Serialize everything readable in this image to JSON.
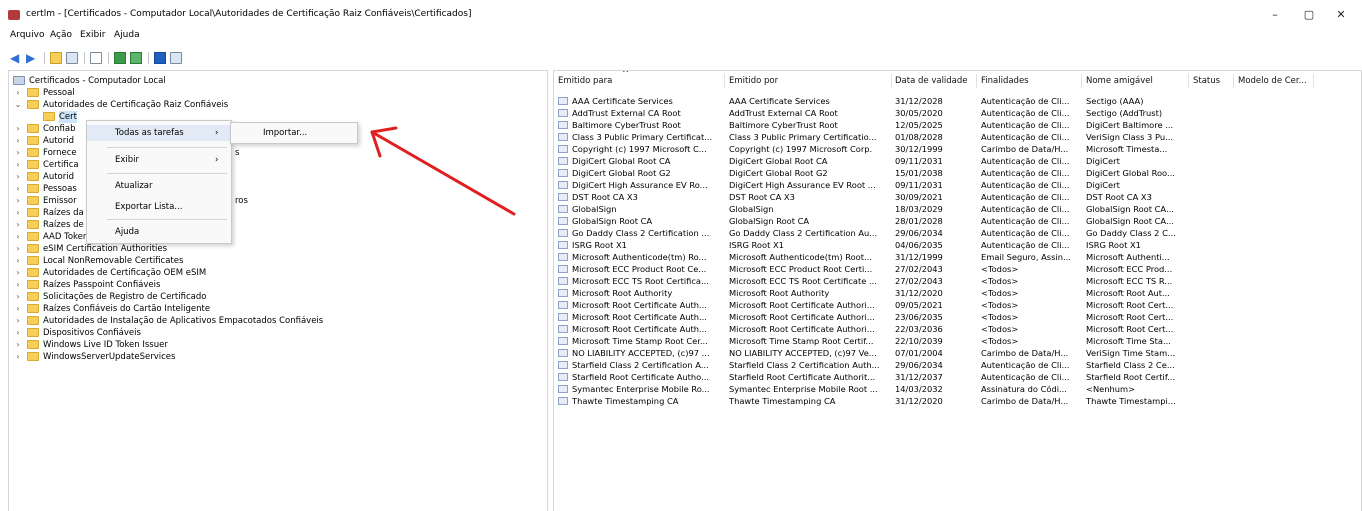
{
  "window": {
    "title": "certlm - [Certificados - Computador Local\\Autoridades de Certificação Raiz Confiáveis\\Certificados]",
    "minimize_glyph": "–",
    "maximize_glyph": "▢",
    "close_glyph": "✕"
  },
  "menu": [
    "Arquivo",
    "Ação",
    "Exibir",
    "Ajuda"
  ],
  "toolbar_icons": [
    "back-arrow-icon",
    "forward-arrow-icon",
    "up-folder-icon",
    "show-hide-tree-icon",
    "delete-icon",
    "refresh-icon",
    "export-list-icon",
    "help-icon",
    "properties-icon"
  ],
  "tree": {
    "root": "Certificados - Computador Local",
    "items": [
      {
        "label": "Pessoal",
        "chev": "›"
      },
      {
        "label": "Autoridades de Certificação Raiz Confiáveis",
        "chev": "⌄"
      },
      {
        "label": "Cert",
        "chev": ""
      },
      {
        "label": "Confiab",
        "chev": "›"
      },
      {
        "label": "Autorid",
        "chev": "›"
      },
      {
        "label": "Fornece",
        "chev": "›"
      },
      {
        "label": "Certifica",
        "chev": "›"
      },
      {
        "label": "Autorid",
        "chev": "›"
      },
      {
        "label": "Pessoas",
        "chev": "›"
      },
      {
        "label": "Emissor",
        "chev": "›"
      },
      {
        "label": "Raízes da Versão Prévia",
        "chev": "›"
      },
      {
        "label": "Raízes de Teste",
        "chev": "›"
      },
      {
        "label": "AAD Token Issuer",
        "chev": "›"
      },
      {
        "label": "eSIM Certification Authorities",
        "chev": "›"
      },
      {
        "label": "Local NonRemovable Certificates",
        "chev": "›"
      },
      {
        "label": "Autoridades de Certificação OEM eSIM",
        "chev": "›"
      },
      {
        "label": "Raízes Passpoint Confiáveis",
        "chev": "›"
      },
      {
        "label": "Solicitações de Registro de Certificado",
        "chev": "›"
      },
      {
        "label": "Raízes Confiáveis do Cartão Inteligente",
        "chev": "›"
      },
      {
        "label": "Autoridades de Instalação de Aplicativos Empacotados Confiáveis",
        "chev": "›"
      },
      {
        "label": "Dispositivos Confiáveis",
        "chev": "›"
      },
      {
        "label": "Windows Live ID Token Issuer",
        "chev": "›"
      },
      {
        "label": "WindowsServerUpdateServices",
        "chev": "›"
      }
    ],
    "peek_texts": [
      "s",
      "ros"
    ]
  },
  "context_menu": {
    "items": [
      "Todas as tarefas",
      "Exibir",
      "Atualizar",
      "Exportar Lista...",
      "Ajuda"
    ],
    "submenu_arrow": "›",
    "submenu": {
      "items": [
        "Importar..."
      ]
    }
  },
  "annotation": {
    "color": "#e02020"
  },
  "list": {
    "columns": [
      "Emitido para",
      "Emitido por",
      "Data de validade",
      "Finalidades",
      "Nome amigável",
      "Status",
      "Modelo de Cer..."
    ],
    "sort_glyph": "^",
    "rows": [
      [
        "AAA Certificate Services",
        "AAA Certificate Services",
        "31/12/2028",
        "Autenticação de Cli...",
        "Sectigo (AAA)"
      ],
      [
        "AddTrust External CA Root",
        "AddTrust External CA Root",
        "30/05/2020",
        "Autenticação de Cli...",
        "Sectigo (AddTrust)"
      ],
      [
        "Baltimore CyberTrust Root",
        "Baltimore CyberTrust Root",
        "12/05/2025",
        "Autenticação de Cli...",
        "DigiCert Baltimore ..."
      ],
      [
        "Class 3 Public Primary Certificat...",
        "Class 3 Public Primary Certificatio...",
        "01/08/2028",
        "Autenticação de Cli...",
        "VeriSign Class 3 Pu..."
      ],
      [
        "Copyright (c) 1997 Microsoft C...",
        "Copyright (c) 1997 Microsoft Corp.",
        "30/12/1999",
        "Carimbo de Data/H...",
        "Microsoft Timesta..."
      ],
      [
        "DigiCert Global Root CA",
        "DigiCert Global Root CA",
        "09/11/2031",
        "Autenticação de Cli...",
        "DigiCert"
      ],
      [
        "DigiCert Global Root G2",
        "DigiCert Global Root G2",
        "15/01/2038",
        "Autenticação de Cli...",
        "DigiCert Global Roo..."
      ],
      [
        "DigiCert High Assurance EV Ro...",
        "DigiCert High Assurance EV Root ...",
        "09/11/2031",
        "Autenticação de Cli...",
        "DigiCert"
      ],
      [
        "DST Root CA X3",
        "DST Root CA X3",
        "30/09/2021",
        "Autenticação de Cli...",
        "DST Root CA X3"
      ],
      [
        "GlobalSign",
        "GlobalSign",
        "18/03/2029",
        "Autenticação de Cli...",
        "GlobalSign Root CA..."
      ],
      [
        "GlobalSign Root CA",
        "GlobalSign Root CA",
        "28/01/2028",
        "Autenticação de Cli...",
        "GlobalSign Root CA..."
      ],
      [
        "Go Daddy Class 2 Certification ...",
        "Go Daddy Class 2 Certification Au...",
        "29/06/2034",
        "Autenticação de Cli...",
        "Go Daddy Class 2 C..."
      ],
      [
        "ISRG Root X1",
        "ISRG Root X1",
        "04/06/2035",
        "Autenticação de Cli...",
        "ISRG Root X1"
      ],
      [
        "Microsoft Authenticode(tm) Ro...",
        "Microsoft Authenticode(tm) Root...",
        "31/12/1999",
        "Email Seguro, Assin...",
        "Microsoft Authenti..."
      ],
      [
        "Microsoft ECC Product Root Ce...",
        "Microsoft ECC Product Root Certi...",
        "27/02/2043",
        "<Todos>",
        "Microsoft ECC Prod..."
      ],
      [
        "Microsoft ECC TS Root Certifica...",
        "Microsoft ECC TS Root Certificate ...",
        "27/02/2043",
        "<Todos>",
        "Microsoft ECC TS R..."
      ],
      [
        "Microsoft Root Authority",
        "Microsoft Root Authority",
        "31/12/2020",
        "<Todos>",
        "Microsoft Root Aut..."
      ],
      [
        "Microsoft Root Certificate Auth...",
        "Microsoft Root Certificate Authori...",
        "09/05/2021",
        "<Todos>",
        "Microsoft Root Cert..."
      ],
      [
        "Microsoft Root Certificate Auth...",
        "Microsoft Root Certificate Authori...",
        "23/06/2035",
        "<Todos>",
        "Microsoft Root Cert..."
      ],
      [
        "Microsoft Root Certificate Auth...",
        "Microsoft Root Certificate Authori...",
        "22/03/2036",
        "<Todos>",
        "Microsoft Root Cert..."
      ],
      [
        "Microsoft Time Stamp Root Cer...",
        "Microsoft Time Stamp Root Certif...",
        "22/10/2039",
        "<Todos>",
        "Microsoft Time Sta..."
      ],
      [
        "NO LIABILITY ACCEPTED, (c)97 ...",
        "NO LIABILITY ACCEPTED, (c)97 Ve...",
        "07/01/2004",
        "Carimbo de Data/H...",
        "VeriSign Time Stam..."
      ],
      [
        "Starfield Class 2 Certification A...",
        "Starfield Class 2 Certification Auth...",
        "29/06/2034",
        "Autenticação de Cli...",
        "Starfield Class 2 Ce..."
      ],
      [
        "Starfield Root Certificate Autho...",
        "Starfield Root Certificate Authorit...",
        "31/12/2037",
        "Autenticação de Cli...",
        "Starfield Root Certif..."
      ],
      [
        "Symantec Enterprise Mobile Ro...",
        "Symantec Enterprise Mobile Root ...",
        "14/03/2032",
        "Assinatura do Códi...",
        "<Nenhum>"
      ],
      [
        "Thawte Timestamping CA",
        "Thawte Timestamping CA",
        "31/12/2020",
        "Carimbo de Data/H...",
        "Thawte Timestampi..."
      ]
    ]
  }
}
